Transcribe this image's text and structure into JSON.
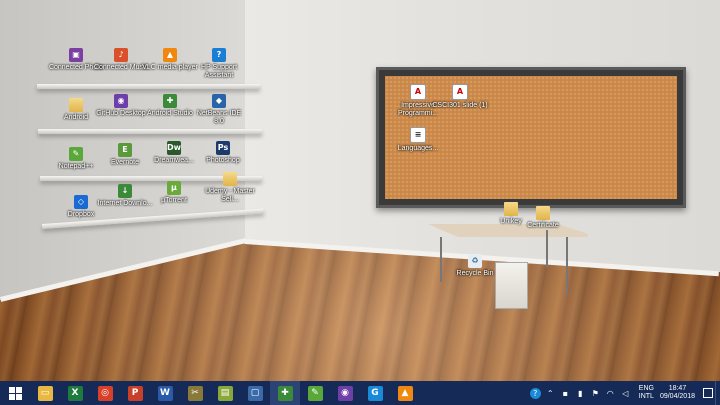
{
  "desktop": {
    "icons": [
      {
        "label": "Connected Photo",
        "color": "#7a3fa0",
        "glyph": "▣",
        "name": "connected-photo-icon"
      },
      {
        "label": "Connected Music",
        "color": "#d9502a",
        "glyph": "♪",
        "name": "connected-music-icon"
      },
      {
        "label": "VLC media player",
        "color": "#f0870e",
        "glyph": "▲",
        "name": "vlc-icon"
      },
      {
        "label": "HP Support Assistant",
        "color": "#1a7fd4",
        "glyph": "?",
        "name": "hp-support-icon"
      },
      {
        "label": "Android",
        "color": "",
        "glyph": "",
        "name": "folder-icon"
      },
      {
        "label": "GitHub Desktop",
        "color": "#6e3fa8",
        "glyph": "◉",
        "name": "github-desktop-icon"
      },
      {
        "label": "Android Studio",
        "color": "#3c8a3a",
        "glyph": "✚",
        "name": "android-studio-icon"
      },
      {
        "label": "NetBeans IDE 8.0",
        "color": "#2a64a8",
        "glyph": "◆",
        "name": "netbeans-icon"
      },
      {
        "label": "Notepad++",
        "color": "#5aa83a",
        "glyph": "✎",
        "name": "notepad-plus-icon"
      },
      {
        "label": "Evernote",
        "color": "#5a9a3a",
        "glyph": "E",
        "name": "evernote-icon"
      },
      {
        "label": "Dreamwea...",
        "color": "#2a5a2a",
        "glyph": "Dw",
        "name": "dreamweaver-icon"
      },
      {
        "label": "Photoshop",
        "color": "#1c3a6c",
        "glyph": "Ps",
        "name": "photoshop-icon"
      },
      {
        "label": "Dropbox",
        "color": "#1a6ad4",
        "glyph": "◇",
        "name": "dropbox-icon"
      },
      {
        "label": "Internet Downlo...",
        "color": "#3a8a3a",
        "glyph": "↓",
        "name": "idm-icon"
      },
      {
        "label": "µTorrent",
        "color": "#6aaa3a",
        "glyph": "µ",
        "name": "utorrent-icon"
      },
      {
        "label": "Udemy - Master Sell...",
        "color": "",
        "glyph": "",
        "name": "folder-icon"
      }
    ],
    "board_icons": [
      {
        "label": "Impressive Programmi...",
        "name": "pdf-file-icon"
      },
      {
        "label": "CSCI301 slide (1)",
        "name": "pdf-file-icon"
      },
      {
        "label": "Languages...",
        "name": "text-file-icon"
      }
    ],
    "floor_icons": [
      {
        "label": "Unikey",
        "name": "folder-icon"
      },
      {
        "label": "Certificate",
        "name": "folder-icon"
      },
      {
        "label": "Recycle Bin",
        "name": "recycle-bin-icon"
      }
    ]
  },
  "taskbar": {
    "apps": [
      {
        "name": "file-explorer-icon",
        "glyph": "▭",
        "color": "#e8b840"
      },
      {
        "name": "excel-icon",
        "glyph": "X",
        "color": "#1f7a3e"
      },
      {
        "name": "chrome-icon",
        "glyph": "◎",
        "color": "#d8402a"
      },
      {
        "name": "powerpoint-icon",
        "glyph": "P",
        "color": "#c8402a"
      },
      {
        "name": "word-icon",
        "glyph": "W",
        "color": "#2a5aa8"
      },
      {
        "name": "tools-icon",
        "glyph": "✂",
        "color": "#8a7a3a"
      },
      {
        "name": "notes-icon",
        "glyph": "▤",
        "color": "#8aa83a"
      },
      {
        "name": "virtualbox-icon",
        "glyph": "▢",
        "color": "#3a6aa8"
      },
      {
        "name": "android-studio-icon",
        "glyph": "✚",
        "color": "#3c8a3a"
      },
      {
        "name": "notepad-icon",
        "glyph": "✎",
        "color": "#5aa83a"
      },
      {
        "name": "github-icon",
        "glyph": "◉",
        "color": "#6e3fa8"
      },
      {
        "name": "gsp-icon",
        "glyph": "G",
        "color": "#1a8ad8"
      },
      {
        "name": "vlc-icon",
        "glyph": "▲",
        "color": "#f0870e"
      }
    ],
    "active_index": 8,
    "tray": {
      "lang_top": "ENG",
      "lang_bottom": "INTL",
      "time": "18:47",
      "date": "09/04/2018"
    }
  }
}
